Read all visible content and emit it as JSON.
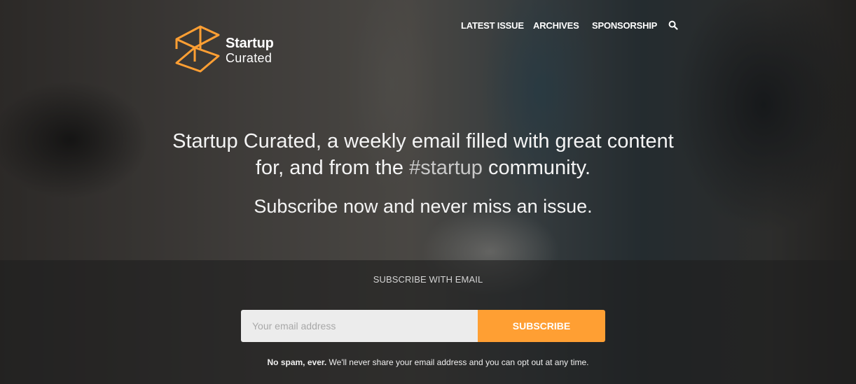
{
  "brand": {
    "name_line1": "Startup",
    "name_line2": "Curated",
    "accent_color": "#ff9f33"
  },
  "nav": {
    "items": [
      {
        "label": "LATEST ISSUE"
      },
      {
        "label": "ARCHIVES"
      },
      {
        "label": "SPONSORSHIP"
      }
    ],
    "search_icon": "search-icon"
  },
  "hero": {
    "headline_part1": "Startup Curated, a weekly email filled with great content for, and from the ",
    "headline_hashtag": "#startup",
    "headline_part2": " community.",
    "subline": "Subscribe now and never miss an issue."
  },
  "subscribe": {
    "label": "SUBSCRIBE WITH EMAIL",
    "email_placeholder": "Your email address",
    "email_value": "",
    "button_label": "SUBSCRIBE",
    "disclaimer_bold": "No spam, ever.",
    "disclaimer_rest": " We'll never share your email address and you can opt out at any time."
  }
}
